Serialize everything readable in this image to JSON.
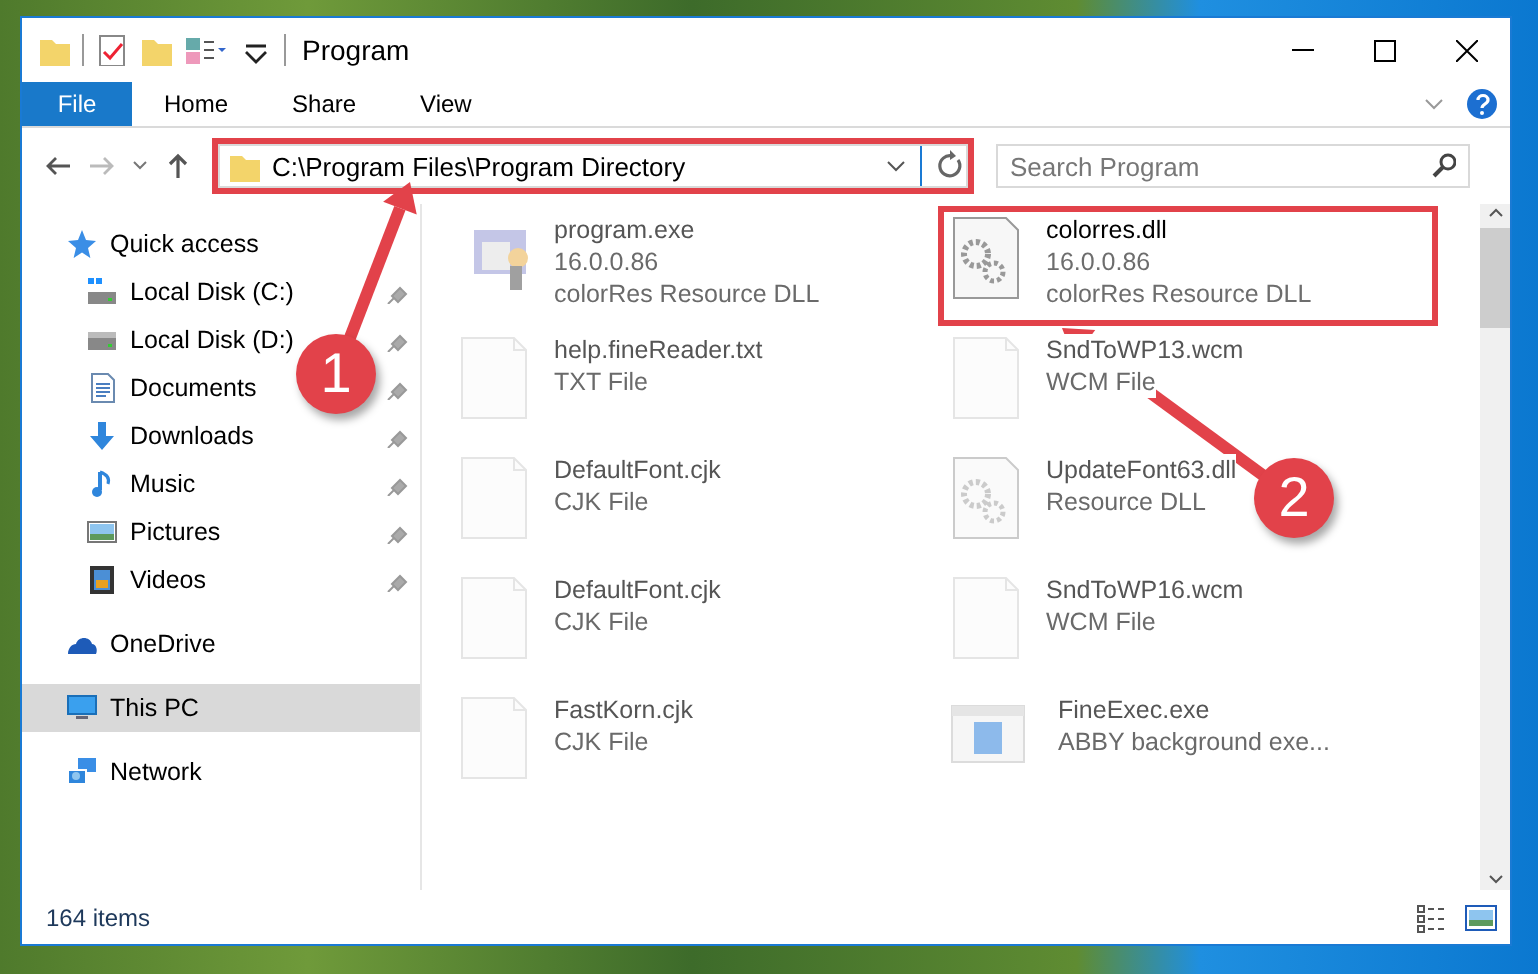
{
  "window": {
    "title": "Program"
  },
  "ribbon_tabs": [
    {
      "label": "File",
      "kind": "menu"
    },
    {
      "label": "Home",
      "kind": "tab"
    },
    {
      "label": "Share",
      "kind": "tab"
    },
    {
      "label": "View",
      "kind": "tab"
    }
  ],
  "address_bar": {
    "path": "C:\\Program Files\\Program Directory",
    "highlighted": true
  },
  "search": {
    "placeholder": "Search Program"
  },
  "sidebar": {
    "items": [
      {
        "label": "Quick access",
        "kind": "star",
        "selected": false,
        "children": [
          {
            "label": "Local Disk (C:)",
            "kind": "windisk",
            "pinned": true
          },
          {
            "label": "Local Disk (D:)",
            "kind": "disk",
            "pinned": true
          },
          {
            "label": "Documents",
            "kind": "docs",
            "pinned": true
          },
          {
            "label": "Downloads",
            "kind": "download",
            "pinned": true
          },
          {
            "label": "Music",
            "kind": "music",
            "pinned": true
          },
          {
            "label": "Pictures",
            "kind": "pictures",
            "pinned": true
          },
          {
            "label": "Videos",
            "kind": "videos",
            "pinned": true
          }
        ]
      },
      {
        "label": "OneDrive",
        "kind": "cloud",
        "selected": false
      },
      {
        "label": "This PC",
        "kind": "pc",
        "selected": true
      },
      {
        "label": "Network",
        "kind": "network",
        "selected": false
      }
    ]
  },
  "files": [
    {
      "name": "program.exe",
      "details": [
        "16.0.0.86",
        "colorRes Resource DLL"
      ],
      "kind": "app",
      "blurred": true,
      "highlighted": false
    },
    {
      "name": "colorres.dll",
      "details": [
        "16.0.0.86",
        "colorRes Resource DLL"
      ],
      "kind": "dll",
      "blurred": false,
      "highlighted": true
    },
    {
      "name": "help.fineReader.txt",
      "details": [
        "TXT File"
      ],
      "kind": "doc",
      "blurred": true,
      "highlighted": false
    },
    {
      "name": "SndToWP13.wcm",
      "details": [
        "WCM File"
      ],
      "kind": "doc",
      "blurred": true,
      "highlighted": false
    },
    {
      "name": "DefaultFont.cjk",
      "details": [
        "CJK File"
      ],
      "kind": "doc",
      "blurred": true,
      "highlighted": false
    },
    {
      "name": "UpdateFont63.dll",
      "details": [
        "Resource DLL"
      ],
      "kind": "dll",
      "blurred": true,
      "highlighted": false
    },
    {
      "name": "DefaultFont.cjk",
      "details": [
        "CJK File"
      ],
      "kind": "doc",
      "blurred": true,
      "highlighted": false
    },
    {
      "name": "SndToWP16.wcm",
      "details": [
        "WCM File"
      ],
      "kind": "doc",
      "blurred": true,
      "highlighted": false
    },
    {
      "name": "FastKorn.cjk",
      "details": [
        "CJK File"
      ],
      "kind": "doc",
      "blurred": true,
      "highlighted": false
    },
    {
      "name": "FineExec.exe",
      "details": [
        "ABBY background exe..."
      ],
      "kind": "window",
      "blurred": true,
      "highlighted": false
    }
  ],
  "status_bar": {
    "item_count": "164 items"
  },
  "annotations": [
    {
      "label": "1"
    },
    {
      "label": "2"
    }
  ]
}
